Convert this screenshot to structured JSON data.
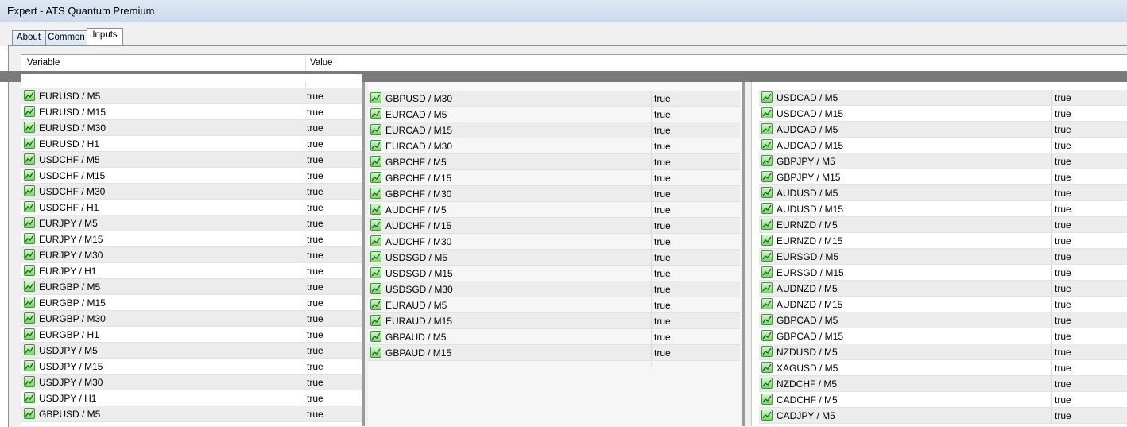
{
  "window": {
    "title": "Expert - ATS Quantum Premium"
  },
  "tabs": [
    {
      "label": "About"
    },
    {
      "label": "Common"
    },
    {
      "label": "Inputs"
    }
  ],
  "columns": {
    "variable": "Variable",
    "value": "Value"
  },
  "panel1": [
    {
      "name": "EURUSD / M5",
      "value": "true"
    },
    {
      "name": "EURUSD / M15",
      "value": "true"
    },
    {
      "name": "EURUSD / M30",
      "value": "true"
    },
    {
      "name": "EURUSD / H1",
      "value": "true"
    },
    {
      "name": "USDCHF / M5",
      "value": "true"
    },
    {
      "name": "USDCHF / M15",
      "value": "true"
    },
    {
      "name": "USDCHF / M30",
      "value": "true"
    },
    {
      "name": "USDCHF / H1",
      "value": "true"
    },
    {
      "name": "EURJPY / M5",
      "value": "true"
    },
    {
      "name": "EURJPY / M15",
      "value": "true"
    },
    {
      "name": "EURJPY / M30",
      "value": "true"
    },
    {
      "name": "EURJPY / H1",
      "value": "true"
    },
    {
      "name": "EURGBP / M5",
      "value": "true"
    },
    {
      "name": "EURGBP / M15",
      "value": "true"
    },
    {
      "name": "EURGBP / M30",
      "value": "true"
    },
    {
      "name": "EURGBP / H1",
      "value": "true"
    },
    {
      "name": "USDJPY / M5",
      "value": "true"
    },
    {
      "name": "USDJPY / M15",
      "value": "true"
    },
    {
      "name": "USDJPY / M30",
      "value": "true"
    },
    {
      "name": "USDJPY / H1",
      "value": "true"
    },
    {
      "name": "GBPUSD / M5",
      "value": "true"
    }
  ],
  "panel2": [
    {
      "name": "GBPUSD / M30",
      "value": "true"
    },
    {
      "name": "EURCAD / M5",
      "value": "true"
    },
    {
      "name": "EURCAD / M15",
      "value": "true"
    },
    {
      "name": "EURCAD / M30",
      "value": "true"
    },
    {
      "name": "GBPCHF / M5",
      "value": "true"
    },
    {
      "name": "GBPCHF / M15",
      "value": "true"
    },
    {
      "name": "GBPCHF / M30",
      "value": "true"
    },
    {
      "name": "AUDCHF / M5",
      "value": "true"
    },
    {
      "name": "AUDCHF / M15",
      "value": "true"
    },
    {
      "name": "AUDCHF / M30",
      "value": "true"
    },
    {
      "name": "USDSGD / M5",
      "value": "true"
    },
    {
      "name": "USDSGD / M15",
      "value": "true"
    },
    {
      "name": "USDSGD / M30",
      "value": "true"
    },
    {
      "name": "EURAUD / M5",
      "value": "true"
    },
    {
      "name": "EURAUD / M15",
      "value": "true"
    },
    {
      "name": "GBPAUD / M5",
      "value": "true"
    },
    {
      "name": "GBPAUD / M15",
      "value": "true"
    }
  ],
  "panel3": [
    {
      "name": "USDCAD / M5",
      "value": "true"
    },
    {
      "name": "USDCAD / M15",
      "value": "true"
    },
    {
      "name": "AUDCAD / M5",
      "value": "true"
    },
    {
      "name": "AUDCAD / M15",
      "value": "true"
    },
    {
      "name": "GBPJPY / M5",
      "value": "true"
    },
    {
      "name": "GBPJPY / M15",
      "value": "true"
    },
    {
      "name": "AUDUSD / M5",
      "value": "true"
    },
    {
      "name": "AUDUSD / M15",
      "value": "true"
    },
    {
      "name": "EURNZD / M5",
      "value": "true"
    },
    {
      "name": "EURNZD / M15",
      "value": "true"
    },
    {
      "name": "EURSGD / M5",
      "value": "true"
    },
    {
      "name": "EURSGD / M15",
      "value": "true"
    },
    {
      "name": "AUDNZD / M5",
      "value": "true"
    },
    {
      "name": "AUDNZD / M15",
      "value": "true"
    },
    {
      "name": "GBPCAD / M5",
      "value": "true"
    },
    {
      "name": "GBPCAD / M15",
      "value": "true"
    },
    {
      "name": "NZDUSD / M5",
      "value": "true"
    },
    {
      "name": "XAGUSD / M5",
      "value": "true"
    },
    {
      "name": "NZDCHF / M5",
      "value": "true"
    },
    {
      "name": "CADCHF / M5",
      "value": "true"
    },
    {
      "name": "CADJPY / M5",
      "value": "true"
    }
  ],
  "icons": {
    "row": "input-parameter-icon"
  },
  "colors": {
    "accent": "#3a9a3a",
    "shade": "#ececec"
  }
}
